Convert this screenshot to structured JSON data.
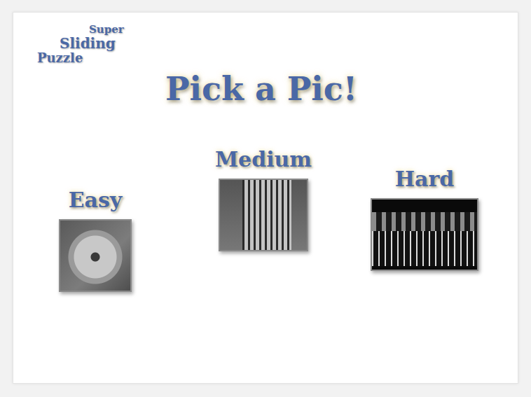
{
  "logo": {
    "lines": [
      "Super",
      "Sliding",
      "Puzzle"
    ]
  },
  "title": "Pick a Pic!",
  "choices": [
    {
      "label": "Easy"
    },
    {
      "label": "Medium"
    },
    {
      "label": "Hard"
    }
  ]
}
